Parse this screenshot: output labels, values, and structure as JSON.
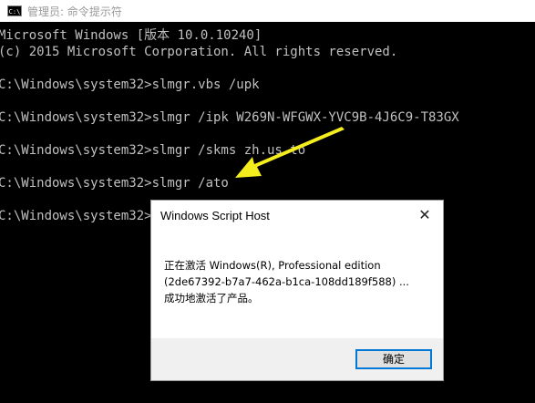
{
  "window": {
    "title": "管理员: 命令提示符",
    "icon": "console-icon"
  },
  "console": {
    "lines": [
      "Microsoft Windows [版本 10.0.10240]",
      "(c) 2015 Microsoft Corporation. All rights reserved.",
      "",
      "C:\\Windows\\system32>slmgr.vbs /upk",
      "",
      "C:\\Windows\\system32>slmgr /ipk W269N-WFGWX-YVC9B-4J6C9-T83GX",
      "",
      "C:\\Windows\\system32>slmgr /skms zh.us.to",
      "",
      "C:\\Windows\\system32>slmgr /ato",
      "",
      "C:\\Windows\\system32>"
    ]
  },
  "annotation": {
    "arrow_color": "#f5ee1f",
    "icon": "arrow-icon"
  },
  "dialog": {
    "title": "Windows Script Host",
    "close_glyph": "✕",
    "message_lines": [
      "正在激活 Windows(R), Professional edition",
      "(2de67392-b7a7-462a-b1ca-108dd189f588) ...",
      "成功地激活了产品。"
    ],
    "ok_label": "确定",
    "accent": "#0078d7"
  }
}
